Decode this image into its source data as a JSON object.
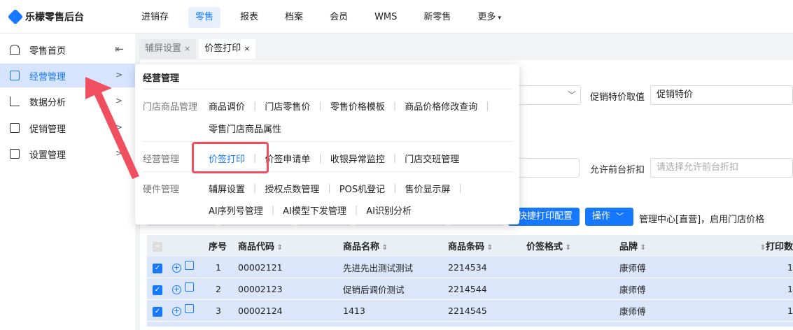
{
  "app": {
    "title": "乐檬零售后台"
  },
  "topnav": [
    "进销存",
    "零售",
    "报表",
    "档案",
    "会员",
    "WMS",
    "新零售",
    "更多"
  ],
  "topnav_active": 1,
  "sidebar": {
    "items": [
      {
        "label": "零售首页",
        "icon": "home-icon",
        "chevron": "collapse"
      },
      {
        "label": "经营管理",
        "icon": "chart-screen-icon",
        "chevron": ">"
      },
      {
        "label": "数据分析",
        "icon": "trend-icon",
        "chevron": ">"
      },
      {
        "label": "促销管理",
        "icon": "coupon-icon",
        "chevron": ">"
      },
      {
        "label": "设置管理",
        "icon": "window-icon",
        "chevron": ">"
      }
    ],
    "active": 1
  },
  "tabs": [
    {
      "label": "辅屏设置",
      "close": "×"
    },
    {
      "label": "价签打印",
      "close": "×"
    }
  ],
  "form": {
    "promo_label": "促销特价取值",
    "promo_value": "促销特价",
    "discount_label": "允许前台折扣",
    "discount_placeholder": "请选择允许前台折扣"
  },
  "toolbar": {
    "quick_print": "快捷打印配置",
    "operate": "操作",
    "info": "管理中心[直营]，启用门店价格"
  },
  "grid": {
    "columns": [
      "序号",
      "商品代码",
      "商品名称",
      "商品条码",
      "价签格式",
      "品牌",
      "打印数"
    ],
    "rows": [
      {
        "no": "1",
        "code": "00002121",
        "name": "先进先出测试测试",
        "barcode": "2214534",
        "format": "",
        "brand": "康师傅",
        "qty": "1"
      },
      {
        "no": "2",
        "code": "00002123",
        "name": "促销后调价测试",
        "barcode": "2214544",
        "format": "",
        "brand": "康师傅",
        "qty": "1"
      },
      {
        "no": "3",
        "code": "00002124",
        "name": "1413",
        "barcode": "2214545",
        "format": "",
        "brand": "康师傅",
        "qty": "1"
      }
    ]
  },
  "dropdown": {
    "title": "经营管理",
    "groups": [
      {
        "category": "门店商品管理",
        "rows": [
          [
            "商品调价",
            "门店零售价",
            "零售价格模板",
            "商品价格修改查询"
          ],
          [
            "零售门店商品属性"
          ]
        ]
      },
      {
        "category": "经营管理",
        "rows": [
          [
            "价签打印",
            "价签申请单",
            "收银异常监控",
            "门店交班管理"
          ]
        ]
      },
      {
        "category": "硬件管理",
        "rows": [
          [
            "辅屏设置",
            "授权点数管理",
            "POS机登记",
            "售价显示屏"
          ],
          [
            "AI序列号管理",
            "AI模型下发管理",
            "AI识别分析"
          ]
        ]
      }
    ],
    "highlighted": "价签打印"
  },
  "colors": {
    "accent": "#1677ff",
    "highlight": "#ef4f5f"
  }
}
